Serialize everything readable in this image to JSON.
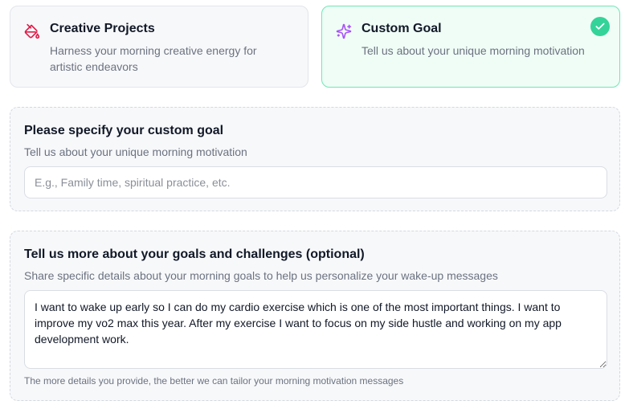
{
  "cards": [
    {
      "title": "Creative Projects",
      "description": "Harness your morning creative energy for artistic endeavors",
      "icon": "paint-bucket-icon",
      "icon_color": "#e11d48",
      "selected": false
    },
    {
      "title": "Custom Goal",
      "description": "Tell us about your unique morning motivation",
      "icon": "sparkles-icon",
      "icon_color": "#a855f7",
      "selected": true
    }
  ],
  "custom_goal": {
    "heading": "Please specify your custom goal",
    "subheading": "Tell us about your unique morning motivation",
    "placeholder": "E.g., Family time, spiritual practice, etc.",
    "value": ""
  },
  "details": {
    "heading": "Tell us more about your goals and challenges (optional)",
    "subheading": "Share specific details about your morning goals to help us personalize your wake-up messages",
    "value": "I want to wake up early so I can do my cardio exercise which is one of the most important things. I want to improve my vo2 max this year. After my exercise I want to focus on my side hustle and working on my app development work.",
    "hint": "The more details you provide, the better we can tailor your morning motivation messages"
  },
  "colors": {
    "selected_border": "#6ee7b7",
    "check_badge": "#34d399"
  }
}
